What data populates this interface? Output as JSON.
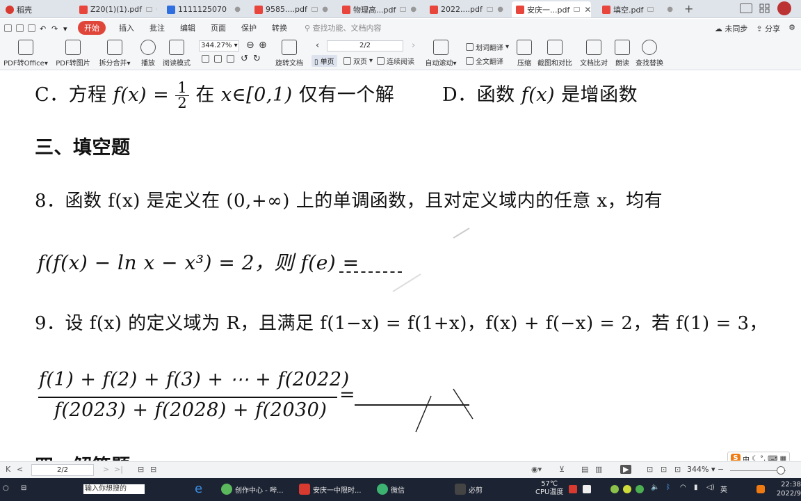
{
  "tabs": [
    {
      "label": "稻壳"
    },
    {
      "label": "Z20(1)(1).pdf"
    },
    {
      "label": "1111125070"
    },
    {
      "label": "9585....pdf"
    },
    {
      "label": "物理高...pdf"
    },
    {
      "label": "2022....pdf"
    },
    {
      "label": "安庆一...pdf"
    },
    {
      "label": "填空.pdf"
    }
  ],
  "tab_new": "+",
  "menu": {
    "active": "开始",
    "items": [
      "插入",
      "批注",
      "编辑",
      "页面",
      "保护",
      "转换"
    ],
    "search_placeholder": "查找功能、文档内容",
    "sync": "未同步",
    "share": "分享"
  },
  "toolbar": {
    "pdf_to_office": "PDF转Office",
    "pdf_to_image": "PDF转图片",
    "split_merge": "拆分合并",
    "play": "播放",
    "read_mode": "阅读模式",
    "zoom": "344.27%",
    "rotate": "旋转文档",
    "page_value": "2/2",
    "single_page": "单页",
    "double_page": "双页",
    "continuous": "连续阅读",
    "auto_scroll": "自动滚动",
    "translate_select": "划词翻译",
    "translate_full": "全文翻译",
    "compress": "压缩",
    "screenshot_compare": "截图和对比",
    "doc_compare": "文档比对",
    "read_aloud": "朗读",
    "find_replace": "查找替换"
  },
  "doc": {
    "c_label": "C．方程",
    "c_middle": "在",
    "c_range": "x∈[0,1)",
    "c_tail": "仅有一个解",
    "d_label": "D．函数",
    "d_tail": "是增函数",
    "section": "三、填空题",
    "q8_text": "8．函数 f(x) 是定义在 (0,+∞) 上的单调函数，且对定义域内的任意 x，均有",
    "q8_formula": "f(f(x) − ln x − x³) = 2，则 f(e) =",
    "q9_text": "9．设 f(x) 的定义域为 R，且满足 f(1−x) = f(1+x)，f(x) + f(−x) = 2，若 f(1) = 3，",
    "q9_numerator": "f(1) + f(2) + f(3) + ⋯ + f(2022)",
    "q9_denominator": "f(2023) + f(2028) + f(2030)",
    "q9_equals": "=",
    "next_section": "四、解答题"
  },
  "ime": {
    "logo": "S",
    "mode": "中"
  },
  "status": {
    "page_value": "2/2",
    "zoom": "344%"
  },
  "taskbar": {
    "search_placeholder": "输入你想搜的",
    "tasks": [
      "创作中心 - 哔...",
      "安庆一中限时...",
      "微信",
      "必剪"
    ],
    "temp": "57℃",
    "cpu_label": "CPU温度",
    "lang": "英",
    "time": "22:38",
    "date": "2022/9"
  }
}
